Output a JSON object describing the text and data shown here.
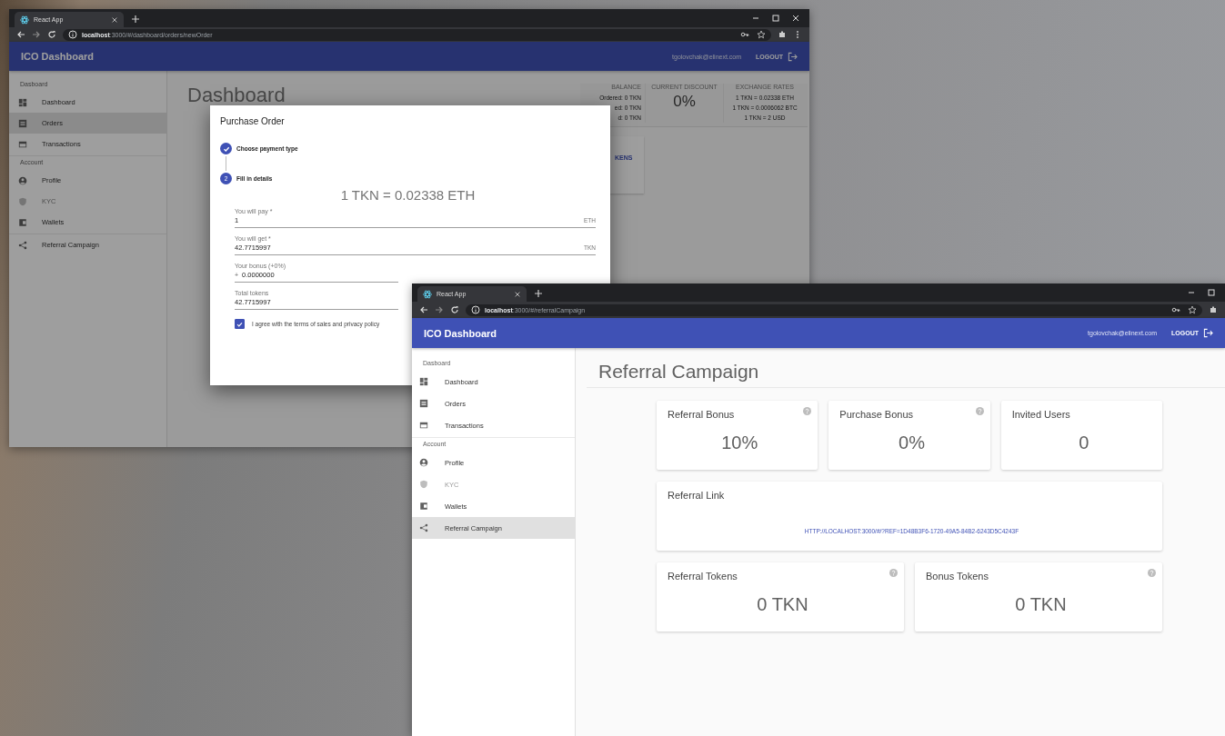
{
  "windows": [
    {
      "kind": "order",
      "tab_title": "React App",
      "url": "**localhost**:3000/#/dashboard/orders/newOrder",
      "app_title": "ICO Dashboard",
      "user_email": "tgolovchak@elinext.com",
      "logout_label": "LOGOUT",
      "sidebar": [
        {
          "label": "Dasboard",
          "items": [
            {
              "label": "Dashboard",
              "selected": false,
              "disabled": false
            },
            {
              "label": "Orders",
              "selected": true,
              "disabled": false
            },
            {
              "label": "Transactions",
              "selected": false,
              "disabled": false
            }
          ]
        },
        {
          "label": "Account",
          "items": [
            {
              "label": "Profile",
              "selected": false,
              "disabled": false
            },
            {
              "label": "KYC",
              "selected": false,
              "disabled": true
            },
            {
              "label": "Wallets",
              "selected": false,
              "disabled": false
            }
          ]
        },
        {
          "items": [
            {
              "label": "Referral Campaign",
              "selected": false,
              "disabled": false
            }
          ]
        }
      ],
      "page_title": "Dashboard",
      "stats": [
        {
          "heading": "BALANCE",
          "lines": [
            "Ordered: 0 TKN",
            "ed: 0 TKN",
            "d: 0 TKN"
          ]
        },
        {
          "heading": "CURRENT DISCOUNT",
          "value": "0%"
        },
        {
          "heading": "EXCHANGE RATES",
          "lines": [
            "1 TKN = 0.02338 ETH",
            "1 TKN = 0.0006062 BTC",
            "1 TKN = 2 USD"
          ]
        }
      ],
      "tokens_card_label": "KENS",
      "dialog": {
        "title": "Purchase Order",
        "steps": [
          {
            "label": "Choose payment type",
            "completed": true
          },
          {
            "label": "Fill in details",
            "completed": false,
            "number": "2"
          }
        ],
        "rate": "1 TKN = 0.02338 ETH",
        "fields": [
          {
            "label": "You will pay *",
            "value": "1",
            "suffix": "ETH"
          },
          {
            "label": "You will get *",
            "value": "42.7715997",
            "suffix": "TKN"
          },
          {
            "label": "Your bonus (+0%)",
            "prefix": "+",
            "value": "0.0000000"
          },
          {
            "label": "Total tokens",
            "value": "42.7715997"
          }
        ],
        "agree": {
          "label": "I agree with the terms of sales and privacy policy",
          "checked": true
        }
      }
    },
    {
      "kind": "referral",
      "tab_title": "React App",
      "url": "**localhost**:3000/#/referralCampaign",
      "app_title": "ICO Dashboard",
      "user_email": "tgolovchak@elinext.com",
      "logout_label": "LOGOUT",
      "sidebar": [
        {
          "label": "Dasboard",
          "items": [
            {
              "label": "Dashboard",
              "selected": false,
              "disabled": false
            },
            {
              "label": "Orders",
              "selected": false,
              "disabled": false
            },
            {
              "label": "Transactions",
              "selected": false,
              "disabled": false
            }
          ]
        },
        {
          "label": "Account",
          "items": [
            {
              "label": "Profile",
              "selected": false,
              "disabled": false
            },
            {
              "label": "KYC",
              "selected": false,
              "disabled": true
            },
            {
              "label": "Wallets",
              "selected": false,
              "disabled": false
            },
            {
              "label": "Referral Campaign",
              "selected": true,
              "disabled": false
            }
          ]
        }
      ],
      "page_title": "Referral Campaign",
      "stat_cards": [
        {
          "title": "Referral Bonus",
          "value": "10%",
          "help": true
        },
        {
          "title": "Purchase Bonus",
          "value": "0%",
          "help": true
        },
        {
          "title": "Invited Users",
          "value": "0",
          "help": false
        }
      ],
      "link_card": {
        "title": "Referral Link",
        "link": "HTTP://LOCALHOST:3000/#/?REF=1D48B3F6-1720-49A5-84B2-6243D5C4243F"
      },
      "token_cards": [
        {
          "title": "Referral Tokens",
          "value": "0 TKN",
          "help": true
        },
        {
          "title": "Bonus Tokens",
          "value": "0 TKN",
          "help": true
        }
      ]
    }
  ]
}
